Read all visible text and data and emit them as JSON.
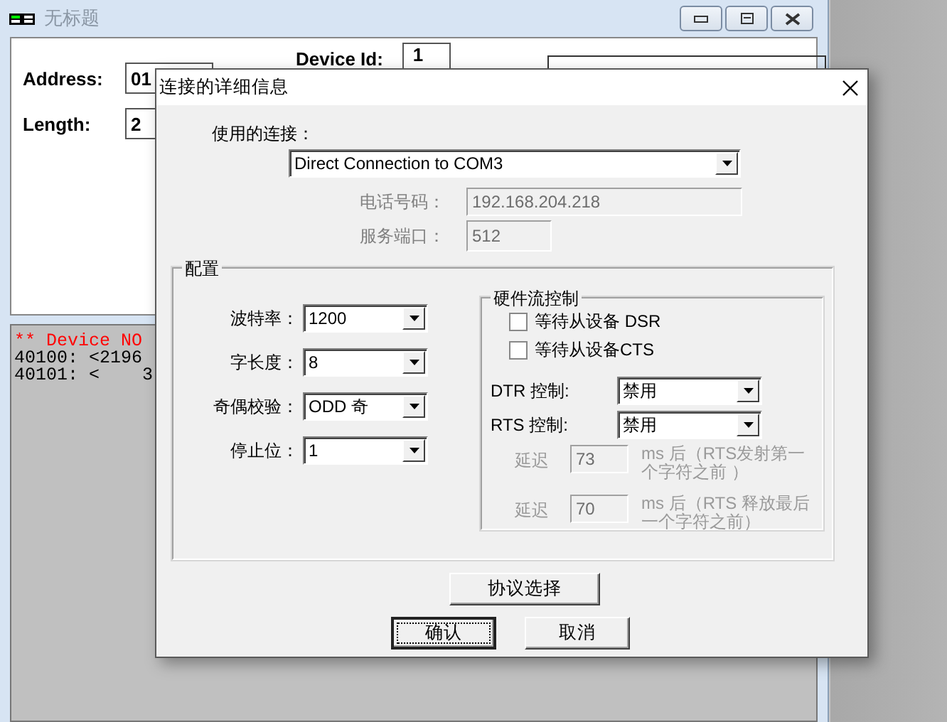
{
  "background_window": {
    "title": "无标题",
    "fields": [
      {
        "label": "Address:",
        "value": "01"
      },
      {
        "label": "Length:",
        "value": "2"
      }
    ],
    "device_id": {
      "label": "Device Id:",
      "value": "1"
    },
    "console_lines": [
      {
        "text": "** Device NO",
        "kind": "error"
      },
      {
        "text": "40100: <2196",
        "kind": "normal"
      },
      {
        "text": "40101: <    3",
        "kind": "normal"
      }
    ]
  },
  "dialog": {
    "title": "连接的详细信息",
    "connection": {
      "label": "使用的连接：",
      "value": "Direct Connection to COM3"
    },
    "address_fields": [
      {
        "label": "电话号码：",
        "value": "192.168.204.218",
        "disabled": true
      },
      {
        "label": "服务端口：",
        "value": "512",
        "disabled": true
      }
    ],
    "config": {
      "title": "配置",
      "settings": [
        {
          "label": "波特率：",
          "value": "1200"
        },
        {
          "label": "字长度：",
          "value": "8"
        },
        {
          "label": "奇偶校验：",
          "value": "ODD 奇"
        },
        {
          "label": "停止位：",
          "value": "1"
        }
      ],
      "flow_control": {
        "title": "硬件流控制",
        "checkboxes": [
          {
            "label": "等待从设备 DSR",
            "checked": false
          },
          {
            "label": "等待从设备CTS",
            "checked": false
          }
        ],
        "controls": [
          {
            "label": "DTR 控制:",
            "value": "禁用"
          },
          {
            "label": "RTS 控制:",
            "value": "禁用"
          }
        ],
        "delays": [
          {
            "label": "延迟",
            "value": "73",
            "note": "ms 后（RTS发射第一个字符之前 ）",
            "disabled": true
          },
          {
            "label": "延迟",
            "value": "70",
            "note": "ms 后（RTS 释放最后一个字符之前）",
            "disabled": true
          }
        ]
      }
    },
    "protocol_button": "协议选择",
    "buttons": [
      {
        "label": "确认",
        "default": true
      },
      {
        "label": "取消",
        "default": false
      }
    ]
  }
}
